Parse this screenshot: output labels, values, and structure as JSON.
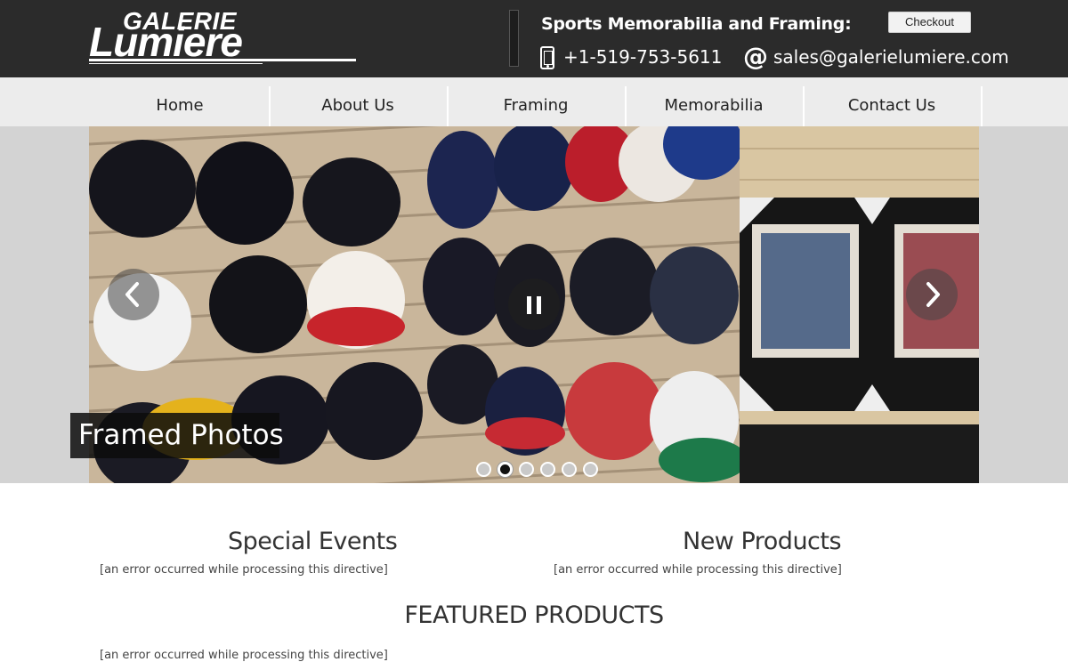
{
  "header": {
    "logo_top": "GALERIE",
    "logo_main": "Lumiere",
    "tagline": "Sports Memorabilia and Framing:",
    "checkout_label": "Checkout",
    "phone": "+1-519-753-5611",
    "email": "sales@galerielumiere.com",
    "phone_icon": "phone-icon",
    "email_icon": "at-icon"
  },
  "nav": {
    "items": [
      {
        "label": "Home"
      },
      {
        "label": "About Us"
      },
      {
        "label": "Framing"
      },
      {
        "label": "Memorabilia"
      },
      {
        "label": "Contact Us"
      }
    ]
  },
  "slider": {
    "caption": "Framed Photos",
    "dot_count": 6,
    "active_dot": 2,
    "prev_icon": "chevron-left-icon",
    "next_icon": "chevron-right-icon",
    "pause_icon": "pause-icon"
  },
  "sections": {
    "special_events": {
      "title": "Special Events",
      "message": "[an error occurred while processing this directive]"
    },
    "new_products": {
      "title": "New Products",
      "message": "[an error occurred while processing this directive]"
    },
    "featured": {
      "title": "FEATURED PRODUCTS",
      "message": "[an error occurred while processing this directive]"
    }
  },
  "colors": {
    "header_bg": "#2b2b2b",
    "nav_bg": "#ececec",
    "slider_bg": "#d3d3d3"
  }
}
